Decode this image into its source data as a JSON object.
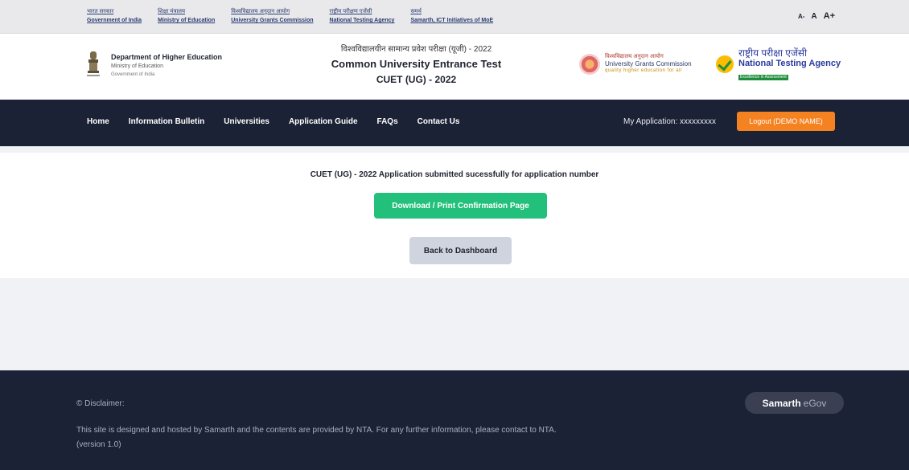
{
  "gov_links": [
    {
      "hi": "भारत सरकार",
      "en": "Government of India"
    },
    {
      "hi": "शिक्षा मंत्रालय",
      "en": "Ministry of Education"
    },
    {
      "hi": "विश्वविद्यालय अनुदान आयोग",
      "en": "University Grants Commission"
    },
    {
      "hi": "राष्ट्रीय परीक्षण एजेंसी",
      "en": "National Testing Agency"
    },
    {
      "hi": "समर्थ",
      "en": "Samarth, ICT Initiatives of MoE"
    }
  ],
  "font_controls": {
    "small": "A-",
    "normal": "A",
    "large": "A+"
  },
  "header": {
    "dept_title": "Department of Higher Education",
    "dept_ministry": "Ministry of Education",
    "dept_gov": "Government of India",
    "title_hindi": "विश्वविद्यालयीन सामान्य प्रवेश परीक्षा (यूजी) - 2022",
    "title_line1": "Common University Entrance Test",
    "title_line2": "CUET (UG) - 2022",
    "ugc_hindi": "विश्वविद्यालय अनुदान आयोग",
    "ugc_english": "University Grants Commission",
    "ugc_tagline": "quality higher education for all",
    "nta_hindi": "राष्ट्रीय परीक्षा एजेंसी",
    "nta_english": "National Testing Agency",
    "nta_tagline": "Excellence in Assessment"
  },
  "nav": {
    "links": [
      "Home",
      "Information Bulletin",
      "Universities",
      "Application Guide",
      "FAQs",
      "Contact Us"
    ],
    "my_application": "My Application: xxxxxxxxx",
    "logout_label": "Logout (DEMO NAME)"
  },
  "content": {
    "success_message": "CUET (UG) - 2022 Application submitted sucessfully for application number",
    "download_label": "Download / Print Confirmation Page",
    "back_label": "Back to Dashboard"
  },
  "footer": {
    "disclaimer_title": "© Disclaimer:",
    "disclaimer_text": "This site is designed and hosted by Samarth and the contents are provided by NTA. For any further information, please contact to NTA. (version 1.0)",
    "badge_part1": "Samarth",
    "badge_part2": "eGov"
  },
  "colors": {
    "nav_bg": "#1c2236",
    "logout_bg": "#f58220",
    "download_bg": "#22c07a",
    "back_bg": "#cfd4de"
  }
}
